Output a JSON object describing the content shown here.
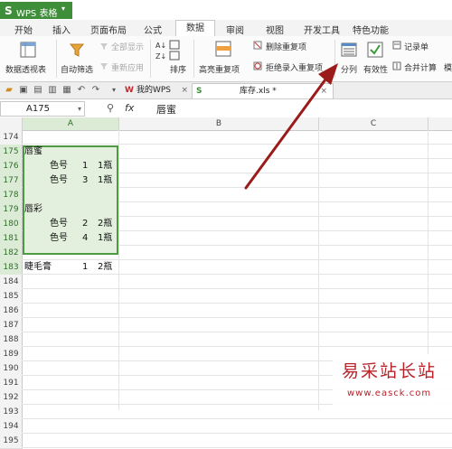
{
  "app": {
    "logo": "S",
    "name": "WPS 表格",
    "menu_arrow": "▾"
  },
  "menu": {
    "tabs": [
      "开始",
      "插入",
      "页面布局",
      "公式",
      "数据",
      "审阅",
      "视图",
      "开发工具",
      "特色功能"
    ],
    "active": "数据"
  },
  "ribbon": {
    "pivot_table": "数据透视表",
    "auto_filter": "自动筛选",
    "show_all": "全部显示",
    "reapply": "重新应用",
    "sort": "排序",
    "highlight_dup": "高亮重复项",
    "delete_dup": "删除重复项",
    "reject_dup": "拒绝录入重复项",
    "split_column": "分列",
    "validity": "有效性",
    "record_sheet": "记录单",
    "merge_calc": "合并计算",
    "overflow": "模"
  },
  "docbar": {
    "tabs": [
      {
        "label": "我的WPS",
        "icon": "W"
      },
      {
        "label": "库存.xls *",
        "icon": "S"
      }
    ]
  },
  "formula_bar": {
    "name_box": "A175",
    "fx": "fx",
    "value": "唇蜜"
  },
  "columns": [
    "A",
    "B",
    "C"
  ],
  "rows": {
    "first": 174,
    "labels": [
      "174",
      "175",
      "176",
      "177",
      "178",
      "179",
      "180",
      "181",
      "182",
      "183",
      "184",
      "185",
      "186",
      "187",
      "188",
      "189",
      "190",
      "191",
      "192",
      "193",
      "194",
      "195"
    ]
  },
  "cells": [
    {
      "row": "175",
      "name": "唇蜜",
      "code": "",
      "qty": "",
      "unit": ""
    },
    {
      "row": "176",
      "name": "",
      "code": "色号",
      "qty": "1",
      "unit": "1瓶"
    },
    {
      "row": "177",
      "name": "",
      "code": "色号",
      "qty": "3",
      "unit": "1瓶"
    },
    {
      "row": "179",
      "name": "唇彩",
      "code": "",
      "qty": "",
      "unit": ""
    },
    {
      "row": "180",
      "name": "",
      "code": "色号",
      "qty": "2",
      "unit": "2瓶"
    },
    {
      "row": "181",
      "name": "",
      "code": "色号",
      "qty": "4",
      "unit": "1瓶"
    },
    {
      "row": "183",
      "name": "睫毛膏",
      "code": "",
      "qty": "1",
      "unit": "2瓶"
    }
  ],
  "watermark": {
    "title": "易采站长站",
    "url": "www.easck.com"
  },
  "colors": {
    "accent": "#3f8f3a",
    "selection_fill": "#e3f0dd",
    "selection_border": "#4e9a43",
    "arrow": "#9b1a1a"
  }
}
